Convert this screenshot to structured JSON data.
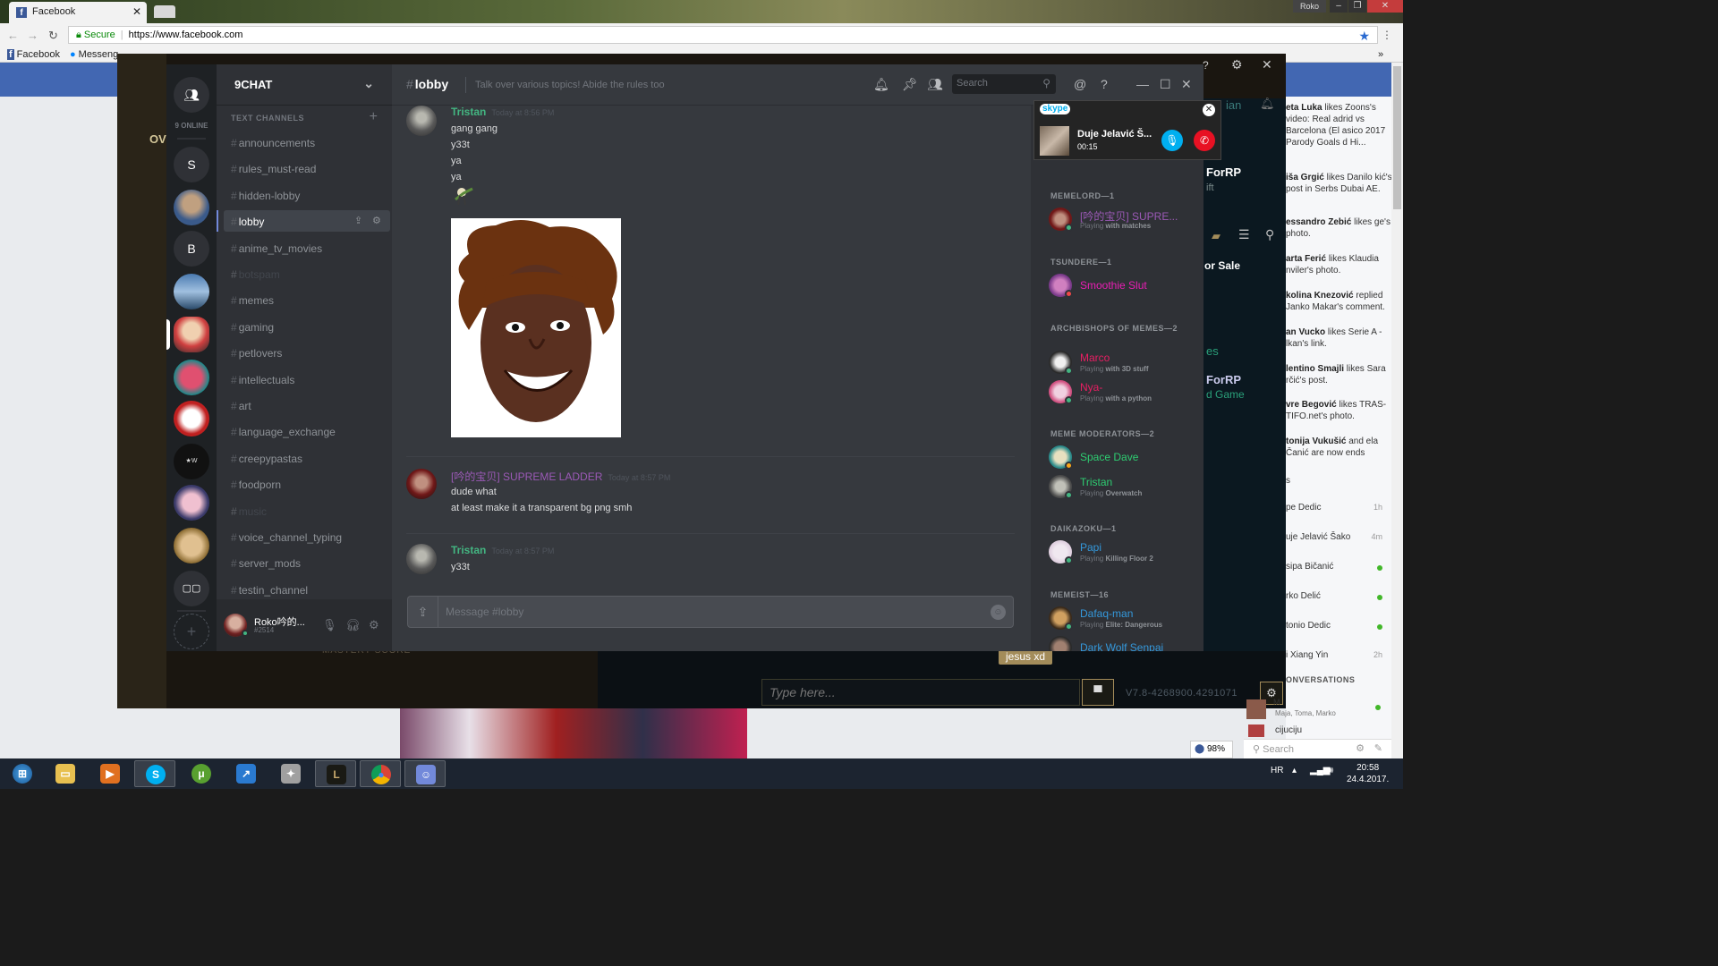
{
  "browser": {
    "tab_title": "Facebook",
    "url": "https://www.facebook.com",
    "secure_label": "Secure",
    "os_user": "Roko",
    "bookmarks": [
      "Facebook",
      "Messeng"
    ]
  },
  "league_client": {
    "overview_label": "OV",
    "mastery_label": "MASTERY SCORE",
    "chat_bubble": "jesus xd",
    "chat_placeholder": "Type here...",
    "version": "V7.8-4268900.4291071",
    "right_texts": [
      "ForRP",
      "ift",
      "or Sale",
      "es",
      "ForRP",
      "d Game",
      "ian"
    ]
  },
  "facebook_sidebar": {
    "ticker": [
      {
        "name": "eta Luka",
        "text": "likes Zoons's video: Real adrid vs Barcelona (El asico 2017 Parody Goals d Hi..."
      },
      {
        "name": "iša Grgić",
        "text": "likes Danilo kić's post in Serbs Dubai AE."
      },
      {
        "name": "essandro Zebić",
        "text": "likes ge's photo."
      },
      {
        "name": "arta Ferić",
        "text": "likes Klaudia nviler's photo."
      },
      {
        "name": "kolina Knezović",
        "text": "replied Janko Makar's comment."
      },
      {
        "name": "an Vucko",
        "text": "likes Serie A - lkan's link."
      },
      {
        "name": "lentino Smajli",
        "text": "likes Sara rčić's post."
      },
      {
        "name": "vre Begović",
        "text": "likes TRAS-TIFO.net's photo."
      },
      {
        "name": "tonija Vukušić",
        "text": "and ela Čanić are now ends"
      }
    ],
    "contacts_header": "s",
    "contacts": [
      {
        "name": "pe Dedic",
        "time": "1h"
      },
      {
        "name": "uje Jelavić Šako",
        "time": "4m"
      },
      {
        "name": "sipa Bičanić",
        "time": ""
      },
      {
        "name": "rko Delić",
        "time": ""
      },
      {
        "name": "tonio Dedic",
        "time": ""
      },
      {
        "name": "i Xiang Yin",
        "time": "2h"
      }
    ],
    "conversations_label": "ONVERSATIONS",
    "conversations": [
      {
        "name": "M",
        "members": "Maja, Toma, Marko"
      },
      {
        "name": "cijuciju",
        "members": ""
      }
    ],
    "search_placeholder": "Search",
    "zoom": "98%"
  },
  "discord": {
    "online_count": "9 ONLINE",
    "guild_letters": [
      "S",
      "B"
    ],
    "server_name": "9CHAT",
    "category": "TEXT CHANNELS",
    "channels": [
      {
        "name": "announcements",
        "state": "normal"
      },
      {
        "name": "rules_must-read",
        "state": "normal"
      },
      {
        "name": "hidden-lobby",
        "state": "normal"
      },
      {
        "name": "lobby",
        "state": "active"
      },
      {
        "name": "anime_tv_movies",
        "state": "normal"
      },
      {
        "name": "botspam",
        "state": "muted"
      },
      {
        "name": "memes",
        "state": "normal"
      },
      {
        "name": "gaming",
        "state": "normal"
      },
      {
        "name": "petlovers",
        "state": "normal"
      },
      {
        "name": "intellectuals",
        "state": "normal"
      },
      {
        "name": "art",
        "state": "normal"
      },
      {
        "name": "language_exchange",
        "state": "normal"
      },
      {
        "name": "creepypastas",
        "state": "normal"
      },
      {
        "name": "foodporn",
        "state": "normal"
      },
      {
        "name": "music",
        "state": "muted"
      },
      {
        "name": "voice_channel_typing",
        "state": "normal"
      },
      {
        "name": "server_mods",
        "state": "normal"
      },
      {
        "name": "testin_channel",
        "state": "normal"
      }
    ],
    "user": {
      "name": "Roko吟的...",
      "tag": "#2514"
    },
    "channel_title": "lobby",
    "topic": "Talk over various topics! Abide the rules too",
    "search_placeholder": "Search",
    "messages": [
      {
        "author": "Tristan",
        "color": "#43b581",
        "time": "Today at 8:56 PM",
        "lines": [
          "gang gang",
          "y33t",
          "ya",
          "ya"
        ]
      },
      {
        "author": "[吟的宝贝] SUPREME LADDER",
        "color": "#9b59b6",
        "time": "Today at 8:57 PM",
        "lines": [
          "dude what",
          "at least make it a transparent bg png smh"
        ]
      },
      {
        "author": "Tristan",
        "color": "#43b581",
        "time": "Today at 8:57 PM",
        "lines": [
          "y33t"
        ]
      }
    ],
    "input_placeholder": "Message #lobby",
    "roles": [
      {
        "name": "MEMELORD—1",
        "members": [
          {
            "name": "[吟的宝贝] SUPRE...",
            "color": "#9b59b6",
            "game_prefix": "Playing",
            "game": "with matches",
            "status": "#43b581"
          }
        ]
      },
      {
        "name": "TSUNDERE—1",
        "members": [
          {
            "name": "Smoothie Slut",
            "color": "#e91eb4",
            "game_prefix": "",
            "game": "",
            "status": "#f04747"
          }
        ]
      },
      {
        "name": "ARCHBISHOPS OF MEMES—2",
        "members": [
          {
            "name": "Marco",
            "color": "#e91e63",
            "game_prefix": "Playing",
            "game": "with 3D stuff",
            "status": "#43b581"
          },
          {
            "name": "Nya-",
            "color": "#e91e63",
            "game_prefix": "Playing",
            "game": "with a python",
            "status": "#43b581"
          }
        ]
      },
      {
        "name": "MEME MODERATORS—2",
        "members": [
          {
            "name": "Space Dave",
            "color": "#2ecc71",
            "game_prefix": "",
            "game": "",
            "status": "#faa61a"
          },
          {
            "name": "Tristan",
            "color": "#2ecc71",
            "game_prefix": "Playing",
            "game": "Overwatch",
            "status": "#43b581"
          }
        ]
      },
      {
        "name": "DAIKAZOKU—1",
        "members": [
          {
            "name": "Papi",
            "color": "#3498db",
            "game_prefix": "Playing",
            "game": "Killing Floor 2",
            "status": "#43b581"
          }
        ]
      },
      {
        "name": "MEMEIST—16",
        "members": [
          {
            "name": "Dafaq-man",
            "color": "#3498db",
            "game_prefix": "Playing",
            "game": "Elite: Dangerous",
            "status": "#43b581"
          },
          {
            "name": "Dark Wolf Senpai",
            "color": "#3498db",
            "game_prefix": "",
            "game": "",
            "status": "#43b581"
          }
        ]
      }
    ]
  },
  "skype": {
    "logo": "skype",
    "caller": "Duje Jelavić Š...",
    "duration": "00:15"
  },
  "taskbar": {
    "language": "HR",
    "time": "20:58",
    "date": "24.4.2017."
  }
}
